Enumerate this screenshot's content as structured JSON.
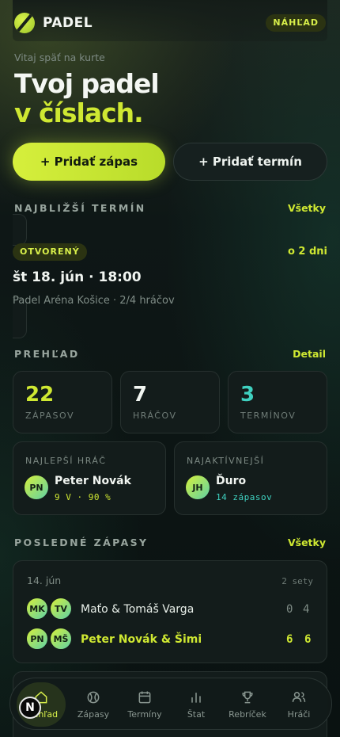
{
  "header": {
    "brand": "PADEL",
    "badge": "NÁHĽAD"
  },
  "hero": {
    "greeting": "Vitaj späť na kurte",
    "line1": "Tvoj padel",
    "line2": "v číslach."
  },
  "actions": {
    "add_match": "+ Pridať zápas",
    "add_term": "+ Pridať termín"
  },
  "next_term": {
    "title": "NAJBLIŽŠÍ TERMÍN",
    "link": "Všetky",
    "status": "OTVORENÝ",
    "when": "o 2 dni",
    "date": "št 18. jún · 18:00",
    "place": "Padel Aréna Košice · 2/4 hráčov"
  },
  "overview": {
    "title": "PREHĽAD",
    "link": "Detail",
    "stats": [
      {
        "value": "22",
        "label": "ZÁPASOV",
        "color": "#cfe832"
      },
      {
        "value": "7",
        "label": "HRÁČOV",
        "color": "#f1f5f1"
      },
      {
        "value": "3",
        "label": "TERMÍNOV",
        "color": "#3fd1c0"
      }
    ],
    "best": {
      "label": "NAJLEPŠÍ HRÁČ",
      "initials": "PN",
      "name": "Peter Novák",
      "sub": "9 V · 90 %"
    },
    "active": {
      "label": "NAJAKTÍVNEJŠÍ",
      "initials": "JH",
      "name": "Ďuro",
      "sub": "14 zápasov"
    }
  },
  "matches": {
    "title": "POSLEDNÉ ZÁPASY",
    "link": "Všetky",
    "items": [
      {
        "date": "14. jún",
        "sets": "2 sety",
        "team1": {
          "a": "MK",
          "b": "TV",
          "name": "Maťo & Tomáš Varga",
          "s1": "0",
          "s2": "4"
        },
        "team2": {
          "a": "PN",
          "b": "MŠ",
          "name": "Peter Novák & Šimi",
          "s1": "6",
          "s2": "6"
        }
      }
    ]
  },
  "nav": {
    "items": [
      {
        "label": "Prehľad",
        "icon": "home-icon"
      },
      {
        "label": "Zápasy",
        "icon": "ball-icon"
      },
      {
        "label": "Termíny",
        "icon": "calendar-icon"
      },
      {
        "label": "Štat",
        "icon": "stats-icon"
      },
      {
        "label": "Rebríček",
        "icon": "trophy-icon"
      },
      {
        "label": "Hráči",
        "icon": "users-icon"
      }
    ]
  },
  "fab": {
    "label": "N"
  }
}
